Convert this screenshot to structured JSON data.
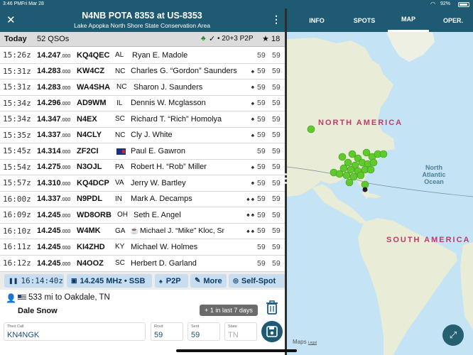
{
  "status_bar": {
    "time": "3:46 PM",
    "date": "Fri Mar 28",
    "battery": "92%"
  },
  "header": {
    "title": "N4NB POTA 8353 at US-8353",
    "subtitle": "Lake Apopka North Shore State Conservation Area",
    "close_icon": "close-icon",
    "menu_icon": "more-vertical-icon"
  },
  "tabs": [
    {
      "label": "INFO",
      "active": false
    },
    {
      "label": "SPOTS",
      "active": false
    },
    {
      "label": "MAP",
      "active": true
    },
    {
      "label": "OPER.",
      "active": false
    }
  ],
  "summary": {
    "today": "Today",
    "qsos": "52 QSOs",
    "stats": "• 20+3 P2P",
    "stars": "18"
  },
  "qsos": [
    {
      "time": "15:26z",
      "freq_main": "14.247",
      "freq_sub": ".000",
      "call": "KQ4QEC",
      "state": "AL",
      "name": "Ryan E. Madole",
      "icon": "",
      "rst_sent": "59",
      "rst_rcvd": "59"
    },
    {
      "time": "15:31z",
      "freq_main": "14.283",
      "freq_sub": ".000",
      "call": "KW4CZ",
      "state": "NC",
      "name": "Charles G. “Gordon” Saunders",
      "icon": "♠",
      "rst_sent": "59",
      "rst_rcvd": "59"
    },
    {
      "time": "15:31z",
      "freq_main": "14.283",
      "freq_sub": ".000",
      "call": "WA4SHA",
      "state": "NC",
      "name": "Sharon J. Saunders",
      "icon": "♠",
      "rst_sent": "59",
      "rst_rcvd": "59"
    },
    {
      "time": "15:34z",
      "freq_main": "14.296",
      "freq_sub": ".000",
      "call": "AD9WM",
      "state": "IL",
      "name": "Dennis W. Mcglasson",
      "icon": "♠",
      "rst_sent": "59",
      "rst_rcvd": "59"
    },
    {
      "time": "15:34z",
      "freq_main": "14.347",
      "freq_sub": ".000",
      "call": "N4EX",
      "state": "SC",
      "name": "Richard T. “Rich” Homolya",
      "icon": "♠",
      "rst_sent": "59",
      "rst_rcvd": "59"
    },
    {
      "time": "15:35z",
      "freq_main": "14.337",
      "freq_sub": ".000",
      "call": "N4CLY",
      "state": "NC",
      "name": "Cly J. White",
      "icon": "♠",
      "rst_sent": "59",
      "rst_rcvd": "59"
    },
    {
      "time": "15:45z",
      "freq_main": "14.314",
      "freq_sub": ".000",
      "call": "ZF2CI",
      "state": "",
      "name": "Paul E. Gawron",
      "icon": "",
      "rst_sent": "59",
      "rst_rcvd": "59"
    },
    {
      "time": "15:54z",
      "freq_main": "14.275",
      "freq_sub": ".000",
      "call": "N3OJL",
      "state": "PA",
      "name": "Robert H. “Rob” Miller",
      "icon": "♠",
      "rst_sent": "59",
      "rst_rcvd": "59"
    },
    {
      "time": "15:57z",
      "freq_main": "14.310",
      "freq_sub": ".000",
      "call": "KQ4DCP",
      "state": "VA",
      "name": "Jerry W. Bartley",
      "icon": "♠",
      "rst_sent": "59",
      "rst_rcvd": "59"
    },
    {
      "time": "16:00z",
      "freq_main": "14.337",
      "freq_sub": ".000",
      "call": "N9PDL",
      "state": "IN",
      "name": "Mark A. Decamps",
      "icon": "♠ ♠",
      "rst_sent": "59",
      "rst_rcvd": "59"
    },
    {
      "time": "16:09z",
      "freq_main": "14.245",
      "freq_sub": ".000",
      "call": "WD8ORB",
      "state": "OH",
      "name": "Seth E. Angel",
      "icon": "♠ ♠",
      "rst_sent": "59",
      "rst_rcvd": "59"
    },
    {
      "time": "16:10z",
      "freq_main": "14.245",
      "freq_sub": ".000",
      "call": "W4MK",
      "state": "GA",
      "name": "Michael J. “Mike” Kloc, Sr",
      "icon": "♠ ♠",
      "rst_sent": "59",
      "rst_rcvd": "59"
    },
    {
      "time": "16:11z",
      "freq_main": "14.245",
      "freq_sub": ".000",
      "call": "KI4ZHD",
      "state": "KY",
      "name": "Michael W. Holmes",
      "icon": "",
      "rst_sent": "59",
      "rst_rcvd": "59"
    },
    {
      "time": "16:12z",
      "freq_main": "14.245",
      "freq_sub": ".000",
      "call": "N4OOZ",
      "state": "SC",
      "name": "Herbert D. Garland",
      "icon": "",
      "rst_sent": "59",
      "rst_rcvd": "59"
    }
  ],
  "controls": {
    "clock": "16:14:40z",
    "frequency": "14.245 MHz • SSB",
    "p2p": "P2P",
    "more": "More",
    "self_spot": "Self-Spot"
  },
  "entry": {
    "distance": "533 mi to Oakdale, TN",
    "name": "Dale Snow",
    "recent": "+ 1 in last 7 days",
    "their_call_label": "Their Call",
    "their_call_value": "KN4NGK",
    "rcvd_label": "Rcvd",
    "rcvd_value": "59",
    "sent_label": "Sent",
    "sent_value": "59",
    "state_label": "State",
    "state_placeholder": "TN"
  },
  "map": {
    "labels": {
      "north_america": "NORTH AMERICA",
      "south_america": "SOUTH AMERICA",
      "north_atlantic": "North Atlantic Ocean",
      "maps_attribution": "Maps",
      "legal": "Legal"
    },
    "colors": {
      "ocean": "#c4e3f4",
      "land": "#e9ecd6",
      "marker": "#5fc92e"
    }
  }
}
